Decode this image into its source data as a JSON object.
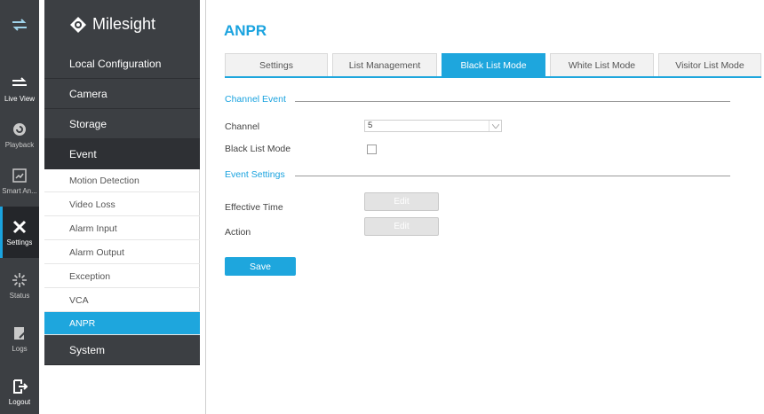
{
  "brand": {
    "name": "Milesight",
    "logo_icon": "milesight-logo-icon"
  },
  "rail": {
    "items": [
      {
        "label": "Live View",
        "icon": "live-view-icon"
      },
      {
        "label": "Playback",
        "icon": "playback-icon"
      },
      {
        "label": "Smart An...",
        "icon": "smart-analysis-icon"
      },
      {
        "label": "Settings",
        "icon": "settings-icon",
        "active": true
      },
      {
        "label": "Status",
        "icon": "status-icon"
      },
      {
        "label": "Logs",
        "icon": "logs-icon"
      },
      {
        "label": "Logout",
        "icon": "logout-icon"
      }
    ]
  },
  "menu": {
    "sections": [
      {
        "label": "Local Configuration"
      },
      {
        "label": "Camera"
      },
      {
        "label": "Storage"
      },
      {
        "label": "Event"
      },
      {
        "label": "System"
      }
    ],
    "event_items": [
      {
        "label": "Motion Detection"
      },
      {
        "label": "Video Loss"
      },
      {
        "label": "Alarm Input"
      },
      {
        "label": "Alarm Output"
      },
      {
        "label": "Exception"
      },
      {
        "label": "VCA"
      },
      {
        "label": "ANPR",
        "active": true
      }
    ]
  },
  "page": {
    "title": "ANPR"
  },
  "tabs": [
    {
      "label": "Settings"
    },
    {
      "label": "List Management"
    },
    {
      "label": "Black List Mode",
      "active": true
    },
    {
      "label": "White List Mode"
    },
    {
      "label": "Visitor List Mode"
    }
  ],
  "channel_event": {
    "title": "Channel Event",
    "channel_label": "Channel",
    "channel_value": "5",
    "black_list_mode_label": "Black List Mode",
    "black_list_mode_checked": false
  },
  "event_settings": {
    "title": "Event Settings",
    "effective_time_label": "Effective Time",
    "effective_time_button": "Edit",
    "action_label": "Action",
    "action_button": "Edit"
  },
  "save_label": "Save",
  "colors": {
    "accent": "#1ea6dd",
    "sidebar": "#3c3f43",
    "sidebar_dark": "#24262a"
  }
}
